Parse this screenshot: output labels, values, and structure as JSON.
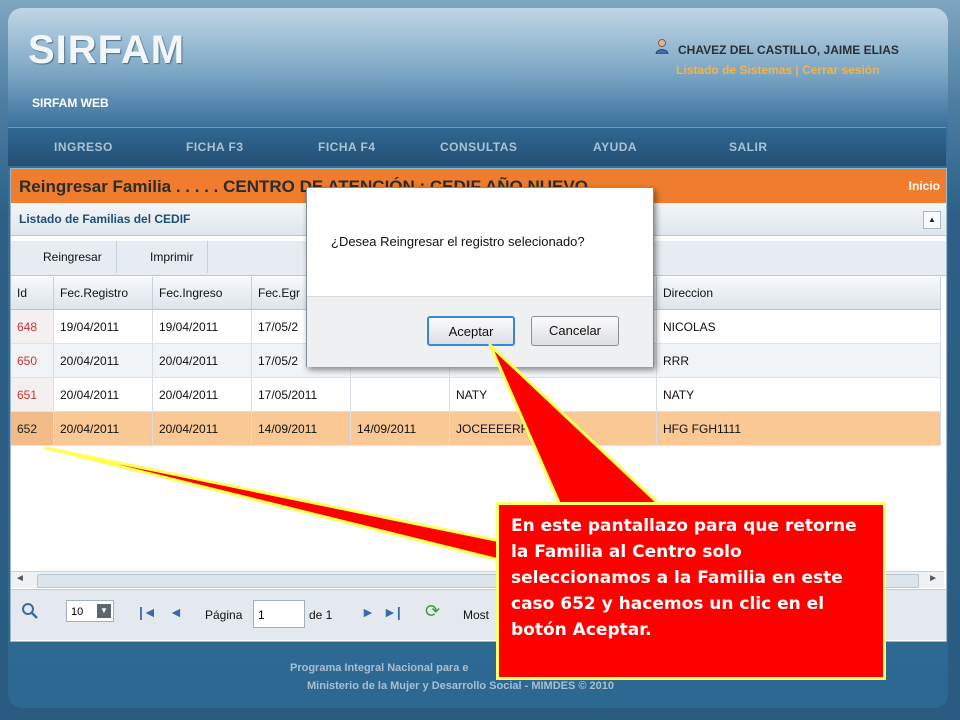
{
  "app": {
    "logo": "SIRFAM",
    "subtitle": "SIRFAM WEB",
    "user_name": "CHAVEZ DEL CASTILLO, JAIME ELIAS",
    "link_systems": "Listado de Sistemas",
    "link_separator": "|",
    "link_logout": "Cerrar sesión"
  },
  "menu": [
    "INGRESO",
    "FICHA F3",
    "FICHA F4",
    "CONSULTAS",
    "AYUDA",
    "SALIR"
  ],
  "panel": {
    "title": "Reingresar Familia . . . . . CENTRO DE ATENCIÓN : CEDIF AÑO NUEVO",
    "home_link": "Inicio",
    "section_title": "Listado de Familias del CEDIF",
    "toolbar": {
      "reingresar": "Reingresar",
      "imprimir": "Imprimir"
    }
  },
  "table": {
    "columns": [
      "Id",
      "Fec.Registro",
      "Fec.Ingreso",
      "Fec.Egr",
      "",
      "",
      "Direccion"
    ],
    "rows": [
      [
        "648",
        "19/04/2011",
        "19/04/2011",
        "17/05/2",
        "",
        "",
        "NICOLAS"
      ],
      [
        "650",
        "20/04/2011",
        "20/04/2011",
        "17/05/2",
        "",
        "",
        "RRR"
      ],
      [
        "651",
        "20/04/2011",
        "20/04/2011",
        "17/05/2011",
        "",
        "NATY",
        "NATY"
      ],
      [
        "652",
        "20/04/2011",
        "20/04/2011",
        "14/09/2011",
        "14/09/2011",
        "JOCEEEERR",
        "HFG FGH1111"
      ]
    ],
    "selected_row_id": "652"
  },
  "pager": {
    "page_size": "10",
    "page_label": "Página",
    "page_value": "1",
    "of_label": "de 1",
    "show_label": "Most"
  },
  "footer": {
    "line1": "Programa Integral Nacional para e",
    "line2": "Ministerio de la Mujer y Desarrollo Social - MIMDES © 2010"
  },
  "dialog": {
    "message": "¿Desea Reingresar el registro selecionado?",
    "accept": "Aceptar",
    "cancel": "Cancelar"
  },
  "callout": {
    "text": "En este pantallazo para que retorne la Familia al Centro solo seleccionamos a la Familia en este caso 652 y hacemos un clic en el botón Aceptar."
  },
  "colors": {
    "header_orange": "#ef7d2d",
    "selected_row": "#f9c895",
    "callout_red": "#ff0000",
    "callout_border": "#ffff66",
    "link_orange": "#f3b347"
  }
}
